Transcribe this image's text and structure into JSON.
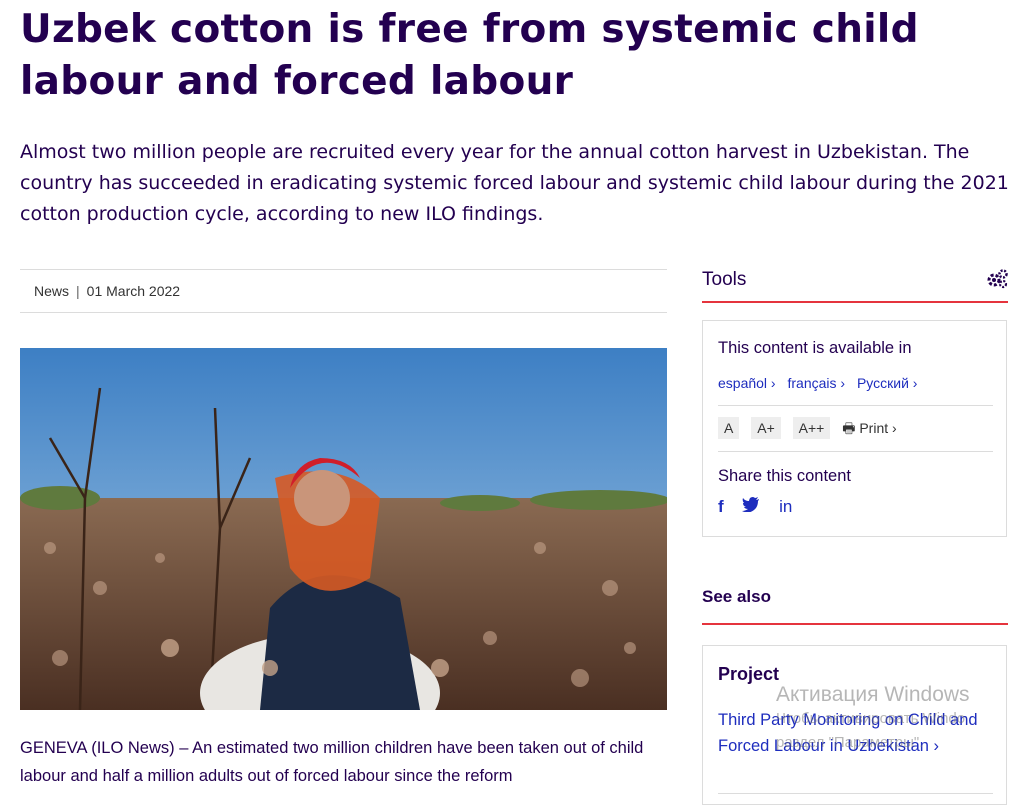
{
  "article": {
    "title": "Uzbek cotton is free from systemic child labour and forced labour",
    "lead": "Almost two million people are recruited every year for the annual cotton harvest in Uzbekistan. The country has succeeded in eradicating systemic forced labour and systemic child labour during the 2021 cotton production cycle, according to new ILO findings.",
    "type": "News",
    "separator": "|",
    "date": "01 March 2022",
    "body": "GENEVA (ILO News) – An estimated two million children have been taken out of child labour and half a million adults out of forced labour since the reform"
  },
  "tools": {
    "heading": "Tools",
    "available_title": "This content is available in",
    "languages": [
      "español ›",
      "français ›",
      "Русский ›"
    ],
    "size_buttons": [
      "A",
      "A+",
      "A++"
    ],
    "print_label": "Print ›",
    "share_title": "Share this content",
    "share_icons": [
      "facebook-icon",
      "twitter-icon",
      "linkedin-icon"
    ],
    "share_glyphs": [
      "f",
      "🐦",
      "in"
    ]
  },
  "see_also": {
    "heading": "See also",
    "project_label": "Project",
    "project_link": "Third Party Monitoring on Child and Forced Labour in Uzbekistan ›"
  },
  "watermark": {
    "line1": "Активация Windows",
    "line2": "Чтобы активировать Windo",
    "line3": "раздел \"Параметры\"."
  },
  "colors": {
    "heading": "#230050",
    "link": "#1e2dbe",
    "accent": "#e5343d"
  }
}
